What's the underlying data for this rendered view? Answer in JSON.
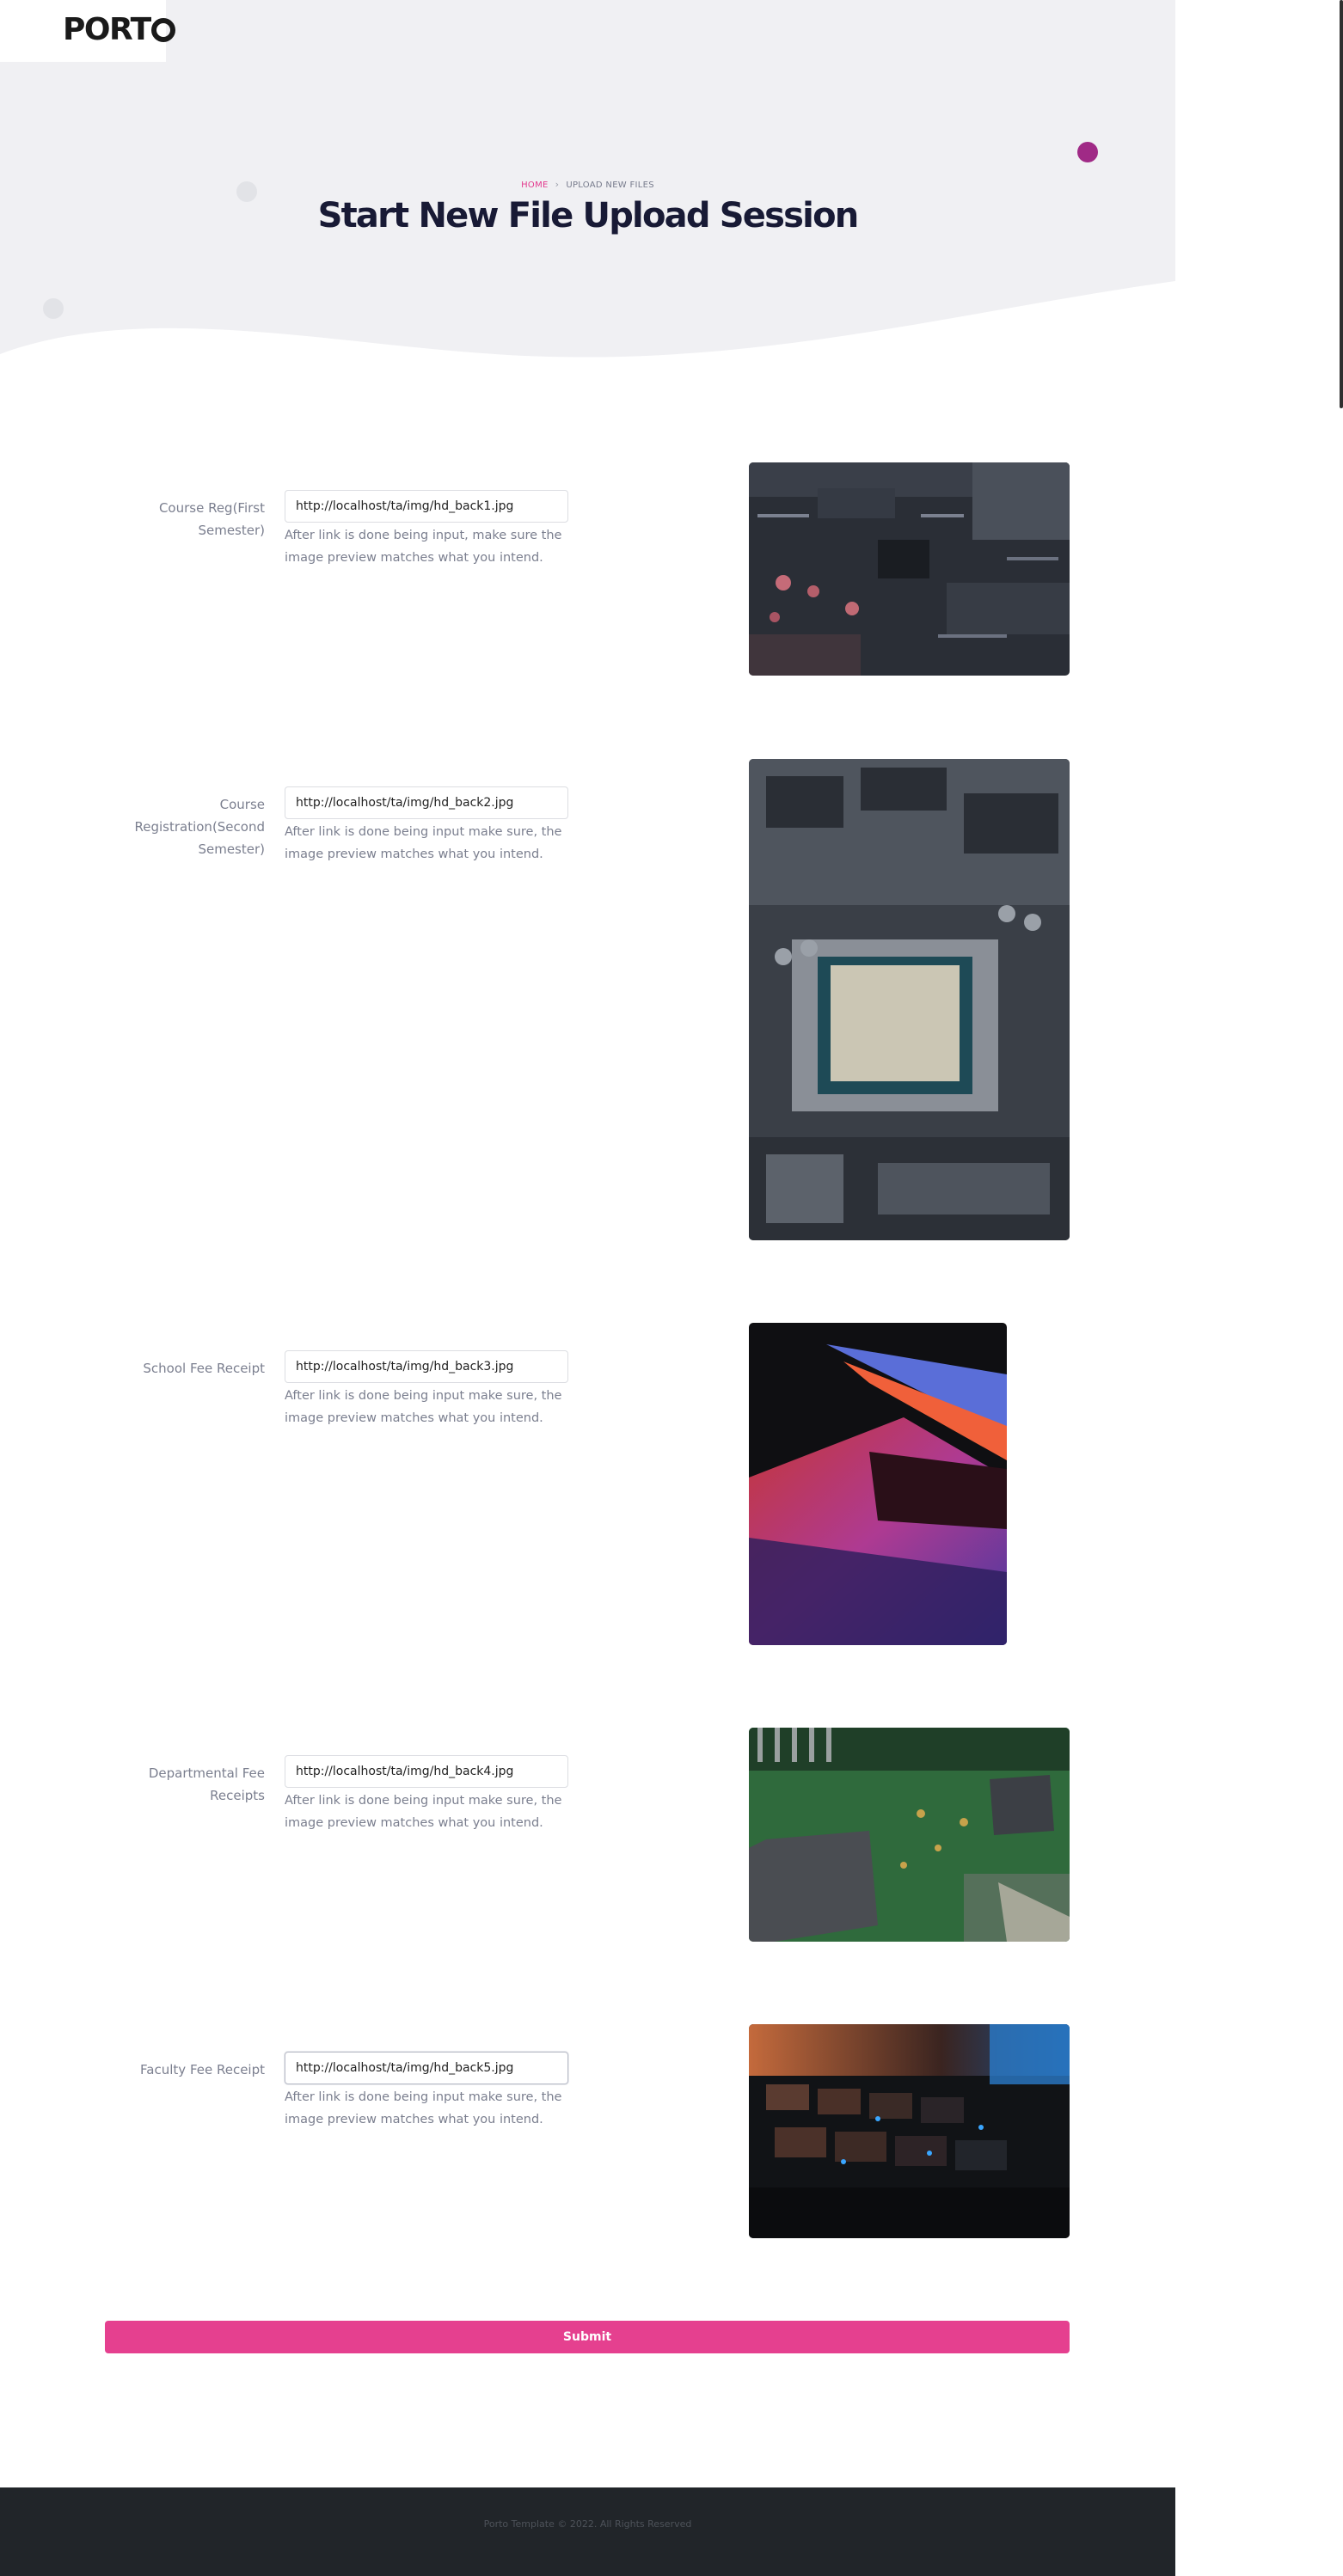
{
  "brand": {
    "logo_text": "PORT"
  },
  "breadcrumb": {
    "home": "HOME",
    "current": "UPLOAD NEW FILES"
  },
  "page_title": "Start New File Upload Session",
  "colors": {
    "accent": "#e5408f",
    "hero_bg": "#f0f0f3",
    "footer_bg": "#212529",
    "title": "#181a35"
  },
  "icons": {
    "breadcrumb_separator": "chevron-right-icon"
  },
  "uploads": [
    {
      "label": "Course Reg(First Semester)",
      "url": "http://localhost/ta/img/hd_back1.jpg",
      "help": "After link is done being input, make sure the image preview matches what you intend."
    },
    {
      "label": "Course Registration(Second Semester)",
      "url": "http://localhost/ta/img/hd_back2.jpg",
      "help": "After link is done being input make sure, the image preview matches what you intend."
    },
    {
      "label": "School Fee Receipt",
      "url": "http://localhost/ta/img/hd_back3.jpg",
      "help": "After link is done being input make sure, the image preview matches what you intend."
    },
    {
      "label": "Departmental Fee Receipts",
      "url": "http://localhost/ta/img/hd_back4.jpg",
      "help": "After link is done being input make sure, the image preview matches what you intend."
    },
    {
      "label": "Faculty Fee Receipt",
      "url": "http://localhost/ta/img/hd_back5.jpg",
      "help": "After link is done being input make sure, the image preview matches what you intend."
    }
  ],
  "previews": [
    {
      "subject": "circuit board closeup"
    },
    {
      "subject": "CPU in motherboard socket"
    },
    {
      "subject": "laptop with colorful lighting"
    },
    {
      "subject": "green circuit board"
    },
    {
      "subject": "backlit keyboard"
    }
  ],
  "submit_label": "Submit",
  "footer": {
    "copyright": "Porto Template © 2022. All Rights Reserved"
  }
}
